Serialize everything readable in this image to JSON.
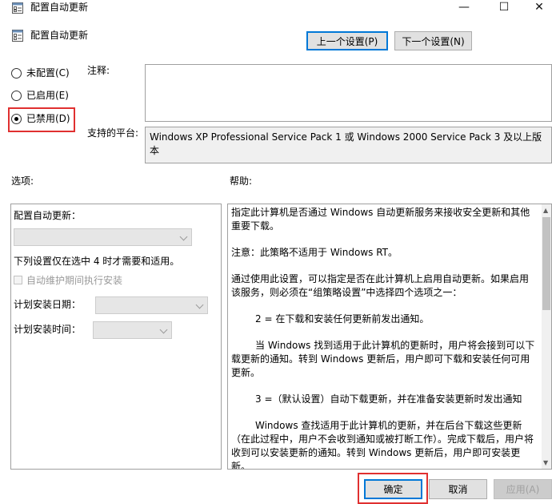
{
  "window": {
    "title": "配置自动更新",
    "minimize": "—",
    "maximize": "☐",
    "close": "✕"
  },
  "header": {
    "title": "配置自动更新"
  },
  "nav": {
    "prev": "上一个设置(P)",
    "next": "下一个设置(N)"
  },
  "state": {
    "not_configured": "未配置(C)",
    "enabled": "已启用(E)",
    "disabled": "已禁用(D)",
    "selected": "disabled"
  },
  "comment": {
    "label": "注释:",
    "value": ""
  },
  "platform": {
    "label": "支持的平台:",
    "value": "Windows XP Professional Service Pack 1 或 Windows 2000 Service Pack 3 及以上版本"
  },
  "options": {
    "heading": "选项:",
    "configure_label": "配置自动更新：",
    "note": "下列设置仅在选中 4 时才需要和适用。",
    "maintenance_checkbox": "自动维护期间执行安装",
    "schedule_day_label": "计划安装日期：",
    "schedule_time_label": "计划安装时间："
  },
  "help": {
    "heading": "帮助:",
    "paragraphs": [
      "指定此计算机是否通过 Windows 自动更新服务来接收安全更新和其他重要下载。",
      "注意：此策略不适用于 Windows RT。",
      "通过使用此设置，可以指定是否在此计算机上启用自动更新。如果启用该服务，则必须在“组策略设置”中选择四个选项之一：",
      "2 = 在下载和安装任何更新前发出通知。",
      "当 Windows 找到适用于此计算机的更新时，用户将会接到可以下载更新的通知。转到 Windows 更新后，用户即可下载和安装任何可用更新。",
      "3 =（默认设置）自动下载更新，并在准备安装更新时发出通知",
      "Windows 查找适用于此计算机的更新，并在后台下载这些更新（在此过程中，用户不会收到通知或被打断工作）。完成下载后，用户将收到可以安装更新的通知。转到 Windows 更新后，用户即可安装更新。"
    ]
  },
  "footer": {
    "ok": "确定",
    "cancel": "取消",
    "apply": "应用(A)"
  },
  "colors": {
    "highlight": "#e03030",
    "focus": "#0078d7"
  }
}
